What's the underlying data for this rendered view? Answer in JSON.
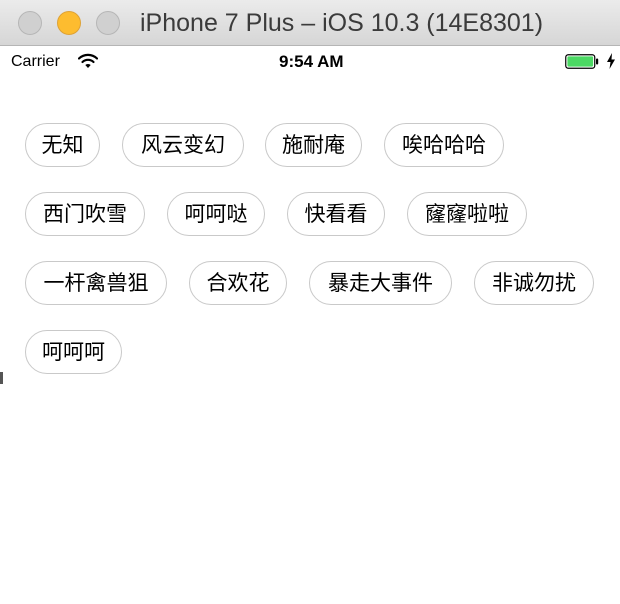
{
  "window": {
    "title": "iPhone 7 Plus – iOS 10.3 (14E8301)",
    "buttons": [
      "close-button",
      "minimize-button",
      "zoom-button"
    ]
  },
  "status_bar": {
    "carrier": "Carrier",
    "time": "9:54 AM",
    "icons": [
      "wifi-icon",
      "battery-icon",
      "charging-bolt-icon"
    ],
    "battery_level": 1.0,
    "battery_color": "#4cd964"
  },
  "tags": [
    [
      "无知",
      "风云变幻",
      "施耐庵",
      "唉哈哈哈"
    ],
    [
      "西门吹雪",
      "呵呵哒",
      "快看看",
      "窿窿啦啦"
    ],
    [
      "一杆禽兽狙",
      "合欢花",
      "暴走大事件",
      "非诚勿扰"
    ],
    [
      "呵呵呵"
    ]
  ],
  "colors": {
    "tag_border": "#c9c9c9",
    "tag_text": "#000000",
    "traffic_minimize": "#fdbc2f"
  }
}
